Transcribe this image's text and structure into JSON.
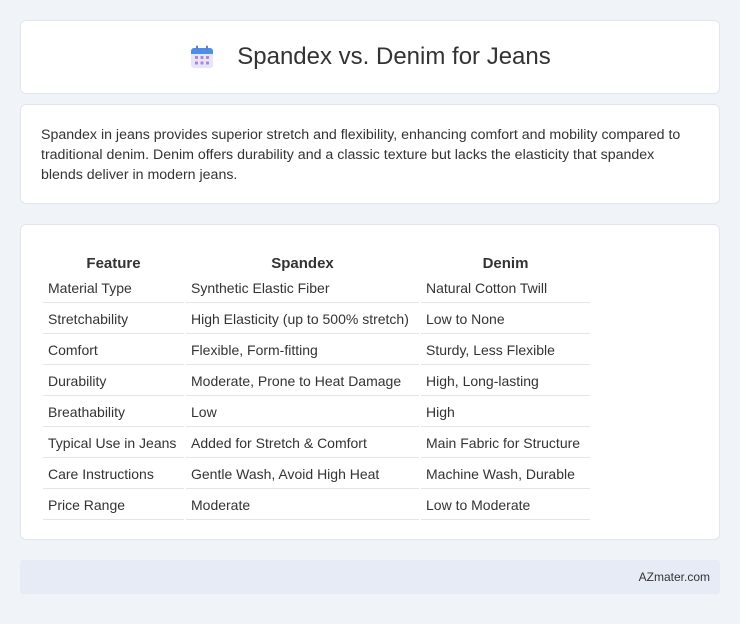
{
  "header": {
    "title": "Spandex vs. Denim for Jeans",
    "icon": "calendar-icon"
  },
  "summary": {
    "text": "Spandex in jeans provides superior stretch and flexibility, enhancing comfort and mobility compared to traditional denim. Denim offers durability and a classic texture but lacks the elasticity that spandex blends deliver in modern jeans."
  },
  "table": {
    "headers": [
      "Feature",
      "Spandex",
      "Denim"
    ],
    "rows": [
      [
        "Material Type",
        "Synthetic Elastic Fiber",
        "Natural Cotton Twill"
      ],
      [
        "Stretchability",
        "High Elasticity (up to 500% stretch)",
        "Low to None"
      ],
      [
        "Comfort",
        "Flexible, Form-fitting",
        "Sturdy, Less Flexible"
      ],
      [
        "Durability",
        "Moderate, Prone to Heat Damage",
        "High, Long-lasting"
      ],
      [
        "Breathability",
        "Low",
        "High"
      ],
      [
        "Typical Use in Jeans",
        "Added for Stretch & Comfort",
        "Main Fabric for Structure"
      ],
      [
        "Care Instructions",
        "Gentle Wash, Avoid High Heat",
        "Machine Wash, Durable"
      ],
      [
        "Price Range",
        "Moderate",
        "Low to Moderate"
      ]
    ]
  },
  "footer": {
    "brand": "AZmater.com"
  },
  "colors": {
    "page_bg": "#f0f3f8",
    "card_bg": "#ffffff",
    "footer_bg": "#e6ebf5",
    "icon_top": "#4a8fe8",
    "icon_body": "#e9e4f7",
    "icon_dots": "#a48ad9"
  }
}
